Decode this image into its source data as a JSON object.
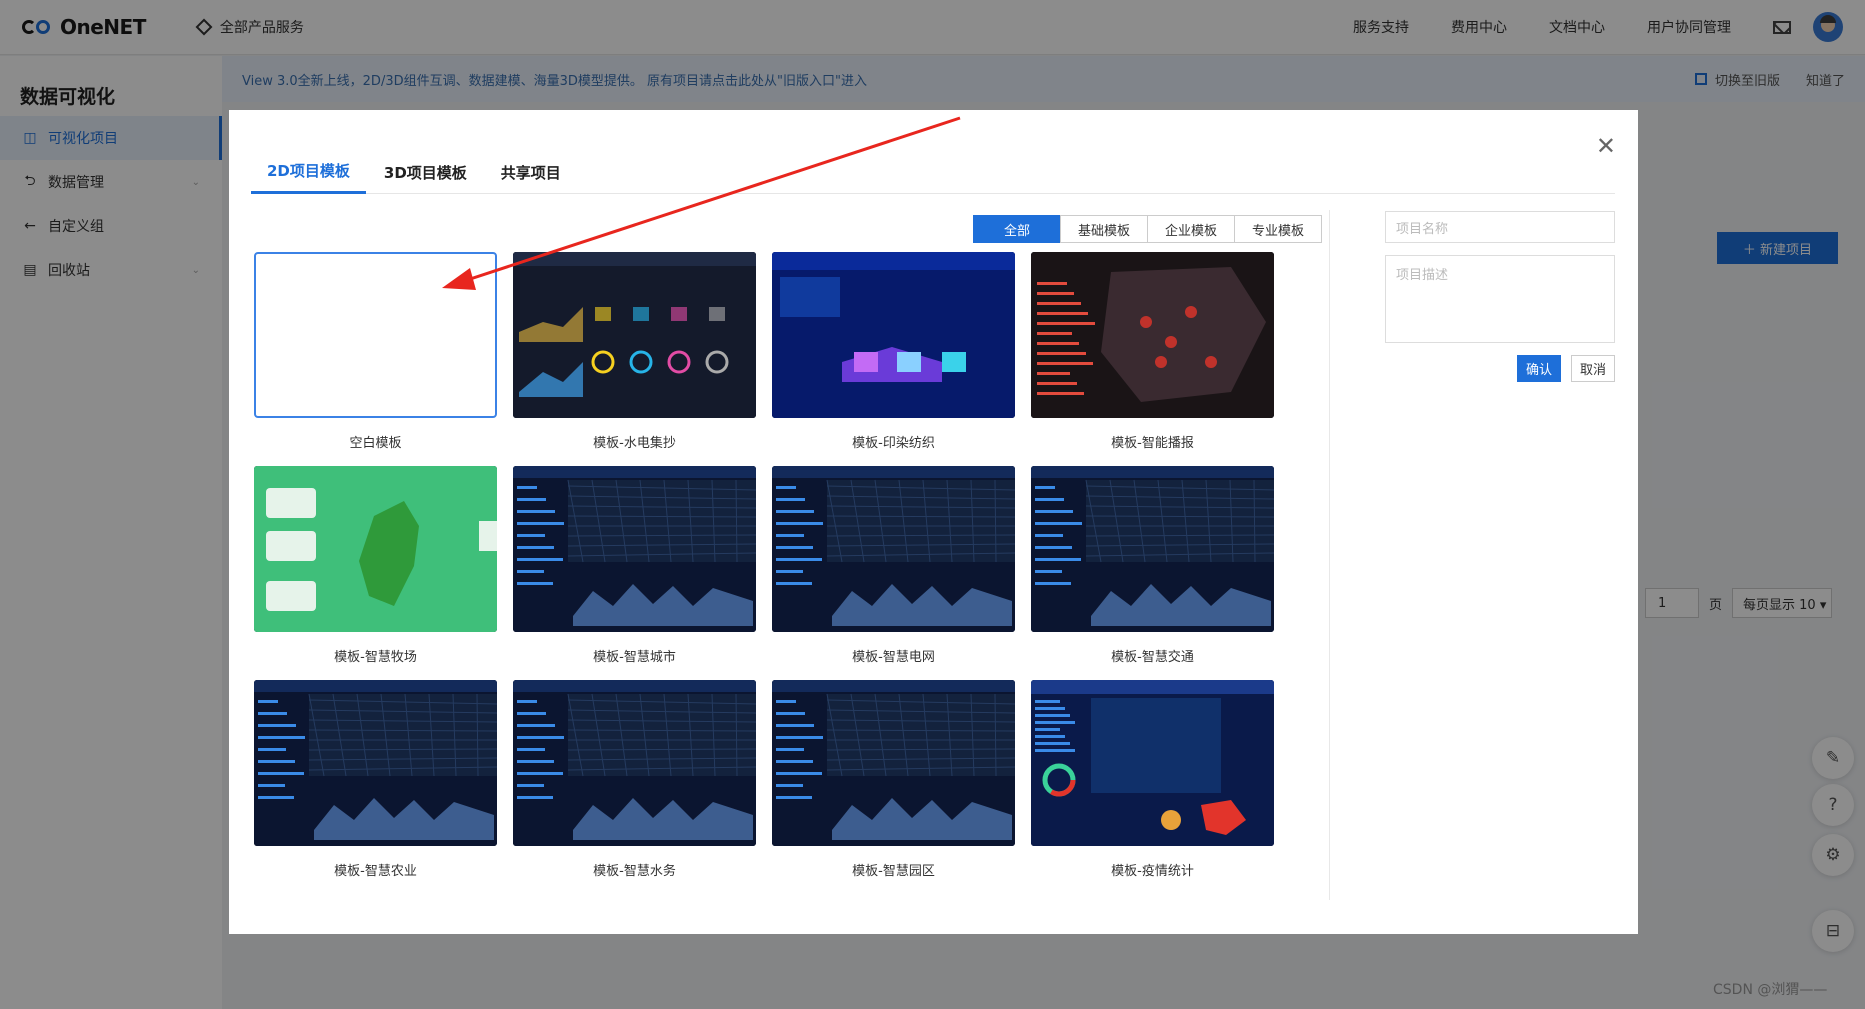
{
  "topbar": {
    "brand": "OneNET",
    "all_products": "全部产品服务",
    "links": [
      "服务支持",
      "费用中心",
      "文档中心",
      "用户协同管理"
    ]
  },
  "sidebar": {
    "title": "数据可视化",
    "items": [
      {
        "label": "可视化项目",
        "icon": "project-icon",
        "active": true
      },
      {
        "label": "数据管理",
        "icon": "data-icon",
        "caret": true
      },
      {
        "label": "自定义组",
        "icon": "custom-group-icon"
      },
      {
        "label": "回收站",
        "icon": "recycle-icon",
        "caret": true
      }
    ]
  },
  "notice": {
    "text": "View 3.0全新上线，2D/3D组件互调、数据建模、海量3D模型提供。 原有项目请点击此处从\"旧版入口\"进入",
    "switch_label": "切换至旧版",
    "dismiss_label": "知道了"
  },
  "page": {
    "new_project": "＋  新建项目",
    "pager_value": "1",
    "pager_unit": "页",
    "page_size": "每页显示 10 ▾"
  },
  "modal": {
    "tabs": [
      "2D项目模板",
      "3D项目模板",
      "共享项目"
    ],
    "active_tab": 0,
    "filters": [
      "全部",
      "基础模板",
      "企业模板",
      "专业模板"
    ],
    "active_filter": 0,
    "templates": [
      {
        "label": "空白模板",
        "kind": "blank"
      },
      {
        "label": "模板-水电集抄",
        "kind": "dashboard-dark"
      },
      {
        "label": "模板-印染纺织",
        "kind": "dashboard-blue"
      },
      {
        "label": "模板-智能播报",
        "kind": "map-red"
      },
      {
        "label": "模板-智慧牧场",
        "kind": "map-green"
      },
      {
        "label": "模板-智慧城市",
        "kind": "city"
      },
      {
        "label": "模板-智慧电网",
        "kind": "city"
      },
      {
        "label": "模板-智慧交通",
        "kind": "city"
      },
      {
        "label": "模板-智慧农业",
        "kind": "city"
      },
      {
        "label": "模板-智慧水务",
        "kind": "city"
      },
      {
        "label": "模板-智慧园区",
        "kind": "city"
      },
      {
        "label": "模板-疫情统计",
        "kind": "epidemic"
      }
    ],
    "form": {
      "name_placeholder": "项目名称",
      "desc_placeholder": "项目描述",
      "confirm": "确认",
      "cancel": "取消"
    }
  },
  "watermark": "CSDN @浏猬——",
  "colors": {
    "accent": "#1e6fd9",
    "arrow": "#e8261e"
  }
}
